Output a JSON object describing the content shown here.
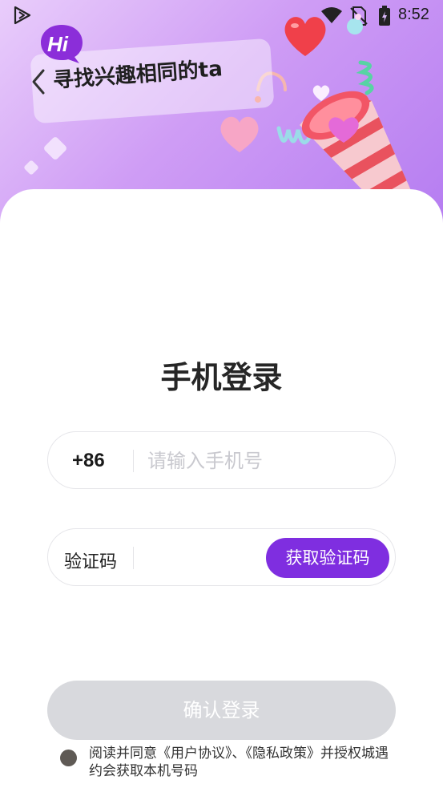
{
  "status_bar": {
    "time": "8:52",
    "icons": [
      "play-icon",
      "wifi-icon",
      "no-sim-icon",
      "battery-charging-icon"
    ]
  },
  "banner": {
    "badge": "Hi",
    "title": "寻找兴趣相同的ta"
  },
  "login": {
    "title": "手机登录",
    "country_code": "+86",
    "phone_placeholder": "请输入手机号",
    "code_label": "验证码",
    "get_code_label": "获取验证码",
    "confirm_label": "确认登录",
    "agreement_text": "阅读并同意《用户协议》、《隐私政策》并授权城遇约会获取本机号码"
  },
  "colors": {
    "accent": "#7f2ee0",
    "hero_gradient": [
      "#e9cdfb",
      "#b57cf1"
    ],
    "disabled_button": "#d8d9dd"
  }
}
